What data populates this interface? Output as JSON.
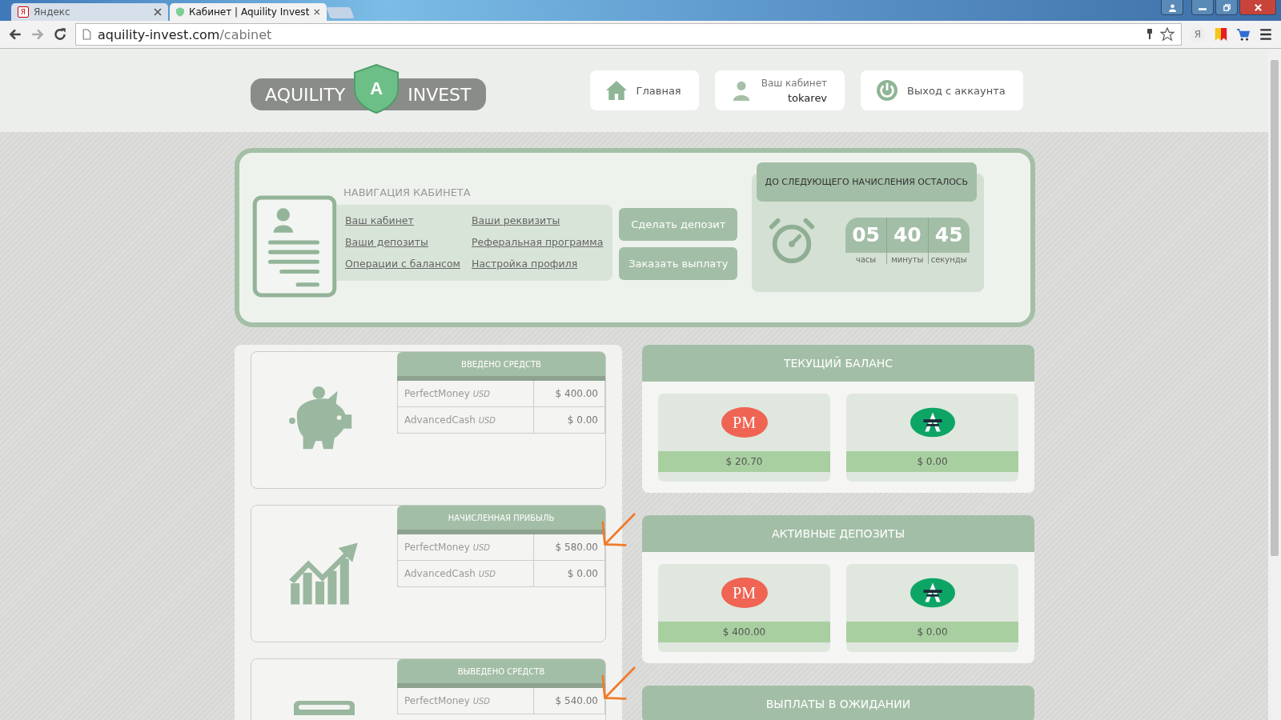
{
  "browser": {
    "tabs": [
      {
        "kind": "yandex",
        "favicon": "Я",
        "title": "Яндекс",
        "selected": false
      },
      {
        "kind": "site",
        "title": "Кабинет | Aquility Invest",
        "selected": true
      }
    ],
    "address": {
      "domain": "aquility-invest.com",
      "path": "/cabinet"
    },
    "ya_button": "Я"
  },
  "header": {
    "logo": {
      "left": "AQUILITY",
      "badge": "A",
      "right": "INVEST"
    },
    "nav": [
      {
        "kind": "home",
        "label": "Главная"
      },
      {
        "kind": "user",
        "label": "Ваш кабинет",
        "sub": "tokarev"
      },
      {
        "kind": "power",
        "label": "Выход с аккаунта"
      }
    ]
  },
  "panel": {
    "nav_title": "НАВИГАЦИЯ КАБИНЕТА",
    "links": [
      "Ваш кабинет",
      "Ваши реквизиты",
      "Ваши депозиты",
      "Реферальная программа",
      "Операции с балансом",
      "Настройка профиля"
    ],
    "actions": [
      "Сделать депозит",
      "Заказать выплату"
    ],
    "timer": {
      "title": "ДО СЛЕДУЮЩЕГО НАЧИСЛЕНИЯ ОСТАЛОСЬ",
      "units": [
        {
          "value": "05",
          "label": "часы"
        },
        {
          "value": "40",
          "label": "минуты"
        },
        {
          "value": "45",
          "label": "секунды"
        }
      ]
    }
  },
  "stats": [
    {
      "kind": "piggy",
      "title": "ВВЕДЕНО СРЕДСТВ",
      "annotated": false,
      "rows": [
        {
          "wallet": "PerfectMoney",
          "currency": "USD",
          "amount": "$ 400.00"
        },
        {
          "wallet": "AdvancedCash",
          "currency": "USD",
          "amount": "$ 0.00"
        }
      ]
    },
    {
      "kind": "growth",
      "title": "НАЧИСЛЕННАЯ ПРИБЫЛЬ",
      "annotated": true,
      "rows": [
        {
          "wallet": "PerfectMoney",
          "currency": "USD",
          "amount": "$ 580.00"
        },
        {
          "wallet": "AdvancedCash",
          "currency": "USD",
          "amount": "$ 0.00"
        }
      ]
    },
    {
      "kind": "wallet",
      "title": "ВЫВЕДЕНО СРЕДСТВ",
      "annotated": true,
      "rows": [
        {
          "wallet": "PerfectMoney",
          "currency": "USD",
          "amount": "$ 540.00"
        }
      ]
    }
  ],
  "balances": [
    {
      "title": "ТЕКУЩИЙ БАЛАНС",
      "wallets": [
        {
          "kind": "pm",
          "logo_text": "PM",
          "amount": "$ 20.70"
        },
        {
          "kind": "advcash",
          "amount": "$ 0.00"
        }
      ]
    },
    {
      "title": "АКТИВНЫЕ ДЕПОЗИТЫ",
      "wallets": [
        {
          "kind": "pm",
          "logo_text": "PM",
          "amount": "$ 400.00"
        },
        {
          "kind": "advcash",
          "amount": "$ 0.00"
        }
      ]
    },
    {
      "title": "ВЫПЛАТЫ В ОЖИДАНИИ"
    }
  ]
}
